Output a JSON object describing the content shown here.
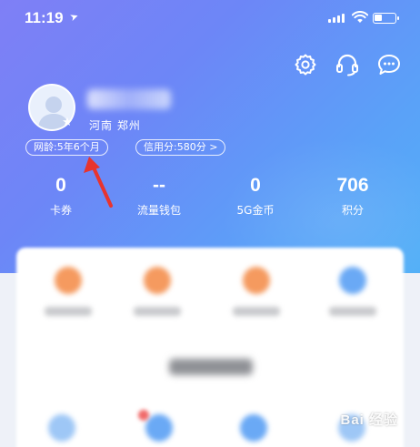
{
  "status_bar": {
    "time": "11:19"
  },
  "header": {
    "icons": [
      "settings-gear-icon",
      "customer-service-headset-icon",
      "message-chat-icon"
    ]
  },
  "profile": {
    "location": "河南 郑州",
    "network_age": "网龄:5年6个月",
    "credit_score": "信用分:580分 >"
  },
  "stats": [
    {
      "value": "0",
      "label": "卡券"
    },
    {
      "value": "--",
      "label": "流量钱包"
    },
    {
      "value": "0",
      "label": "5G金币"
    },
    {
      "value": "706",
      "label": "积分"
    }
  ],
  "colors": {
    "header_gradient_start": "#7f7ff6",
    "header_gradient_end": "#53b0f7",
    "annotation_arrow": "#e8342f",
    "service_orange": "#f59a5f",
    "service_blue": "#6aa9f5"
  },
  "watermark": "Bai 经验"
}
